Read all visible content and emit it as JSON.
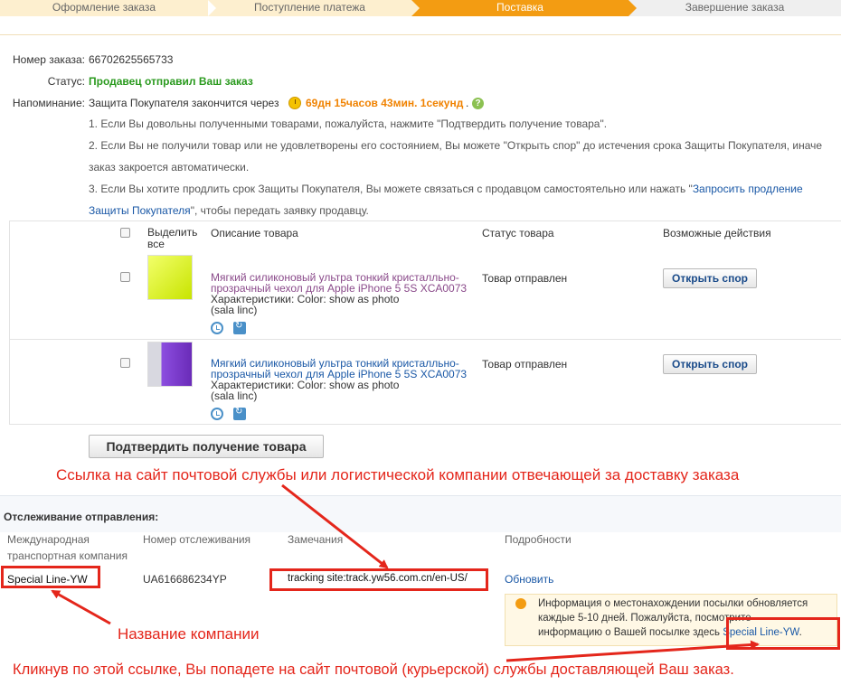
{
  "steps": [
    "Оформление заказа",
    "Поступление платежа",
    "Поставка",
    "Завершение заказа"
  ],
  "order": {
    "number_label": "Номер заказа:",
    "number": "66702625565733",
    "status_label": "Статус:",
    "status": "Продавец отправил Ваш заказ",
    "reminder_label": "Напоминание:",
    "reminder_text": "Защита Покупателя закончится через",
    "countdown": "69дн 15часов 43мин. 1секунд",
    "countdown_suffix": ".",
    "help_icon": "?"
  },
  "info": {
    "line1": "1. Если Вы довольны полученными товарами, пожалуйста, нажмите \"Подтвердить получение товара\".",
    "line2": "2. Если Вы не получили товар или не удовлетворены его состоянием, Вы можете \"Открыть спор\" до истечения срока Защиты Покупателя, иначе",
    "line2b": "заказ закроется автоматически.",
    "line3": "3. Если Вы хотите продлить срок Защиты Покупателя, Вы можете связаться с продавцом самостоятельно или нажать \"",
    "line3_link": "Запросить продление",
    "line4_link": "Защиты Покупателя",
    "line4_rest": "\", чтобы передать заявку продавцу."
  },
  "table": {
    "headers": {
      "select_all": "Выделить все",
      "description": "Описание товара",
      "status": "Статус товара",
      "actions": "Возможные действия"
    },
    "rows": [
      {
        "title": "Мягкий силиконовый ультра тонкий кристалльно-прозрачный чехол для Apple iPhone 5 5S XCA0073",
        "props": "Характеристики: Color: show as photo",
        "seller": "(sala linc)",
        "status": "Товар отправлен",
        "action": "Открыть спор",
        "image_color": "#d8f01a"
      },
      {
        "title": "Мягкий силиконовый ультра тонкий кристалльно-прозрачный чехол для Apple iPhone 5 5S XCA0073",
        "props": "Характеристики: Color: show as photo",
        "seller": "(sala linc)",
        "status": "Товар отправлен",
        "action": "Открыть спор",
        "image_color": "#7b3fc8"
      }
    ],
    "confirm_button": "Подтвердить получение товара"
  },
  "annotations": {
    "top": "Ссылка на сайт почтовой службы или логистической компании отвечающей за доставку заказа",
    "company": "Название компании",
    "bottom": "Кликнув по этой ссылке, Вы попадете на сайт почтовой (курьерской) службы доставляющей Ваш заказ."
  },
  "tracking": {
    "title": "Отслеживание отправления:",
    "col_company_1": "Международная",
    "col_company_2": "транспортная компания",
    "col_number": "Номер отслеживания",
    "col_remarks": "Замечания",
    "col_details": "Подробности",
    "company": "Special Line-YW",
    "number": "UA616686234YP",
    "remarks": "tracking site:track.yw56.com.cn/en-US/",
    "refresh": "Обновить",
    "note_1": "Информация о местонахождении посылки обновляется",
    "note_2": "каждые 5-10 дней. Пожалуйста, посмотрите",
    "note_3": "информацию о Вашей посылке здесь",
    "note_link": "Special Line-YW",
    "note_end": "."
  },
  "colors": {
    "accent": "#f39c12",
    "annotation_red": "#e4261b",
    "link": "#1a58a6",
    "status_green": "#2a9a1e"
  }
}
